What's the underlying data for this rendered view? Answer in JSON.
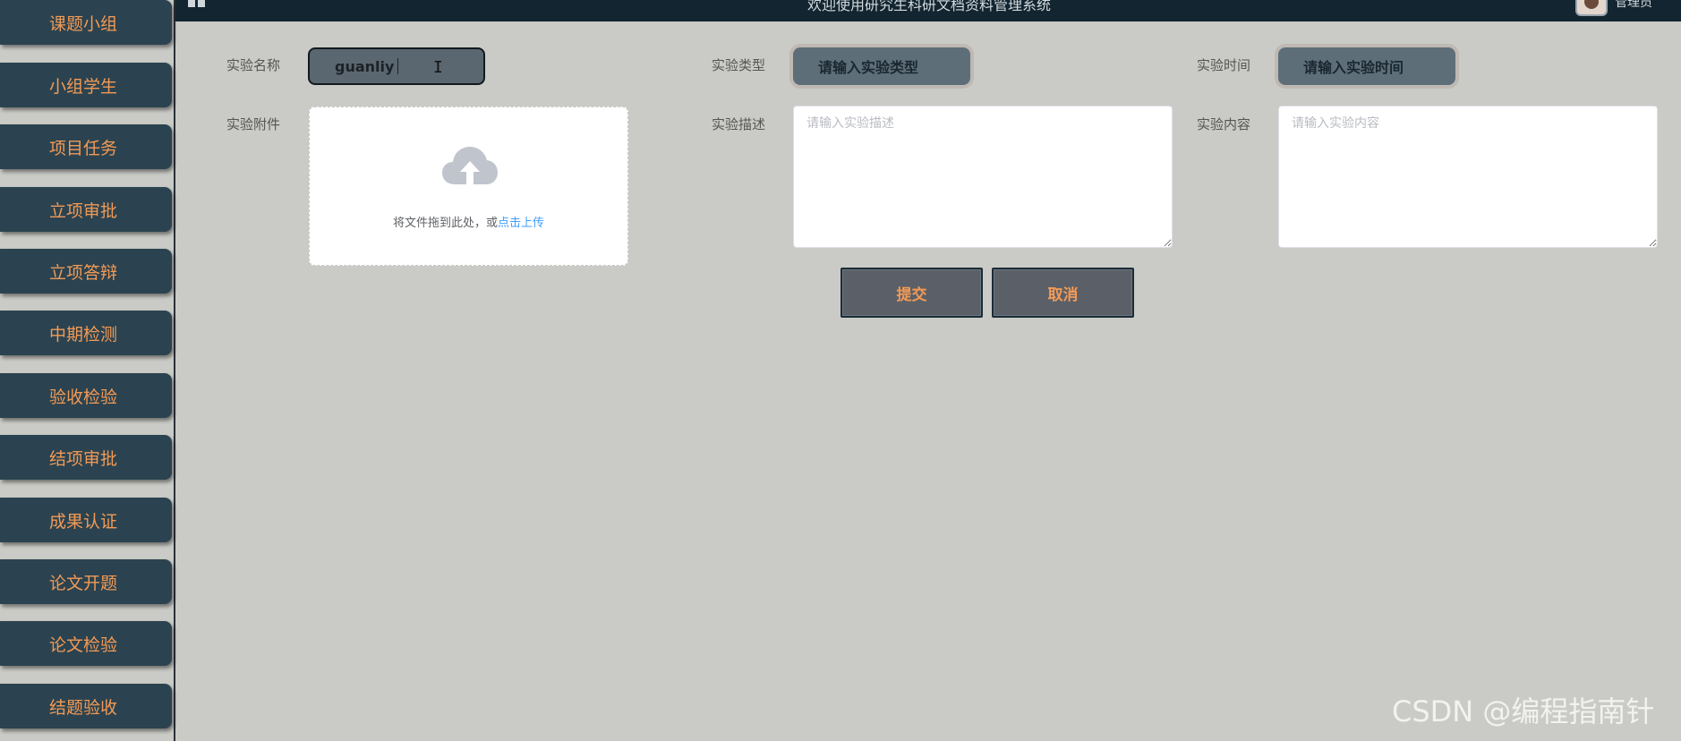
{
  "sidebar": {
    "items": [
      {
        "label": "课题小组"
      },
      {
        "label": "小组学生"
      },
      {
        "label": "项目任务"
      },
      {
        "label": "立项审批"
      },
      {
        "label": "立项答辩"
      },
      {
        "label": "中期检测"
      },
      {
        "label": "验收检验"
      },
      {
        "label": "结项审批"
      },
      {
        "label": "成果认证"
      },
      {
        "label": "论文开题"
      },
      {
        "label": "论文检验"
      },
      {
        "label": "结题验收"
      }
    ]
  },
  "topbar": {
    "welcome": "欢迎使用研究生科研文档资料管理系统",
    "username": "管理员"
  },
  "form": {
    "name_label": "实验名称",
    "name_value": "guanliy",
    "type_label": "实验类型",
    "type_placeholder": "请输入实验类型",
    "time_label": "实验时间",
    "time_placeholder": "请输入实验时间",
    "attachment_label": "实验附件",
    "upload_text": "将文件拖到此处，或",
    "upload_link": "点击上传",
    "desc_label": "实验描述",
    "desc_placeholder": "请输入实验描述",
    "content_label": "实验内容",
    "content_placeholder": "请输入实验内容",
    "submit_label": "提交",
    "cancel_label": "取消"
  },
  "watermark": "CSDN @编程指南针",
  "colors": {
    "sidebar_bg": "#2b4350",
    "accent_orange": "#f39a55",
    "page_bg": "#cacbc6",
    "topbar_bg": "#122530",
    "link_blue": "#409eff"
  }
}
